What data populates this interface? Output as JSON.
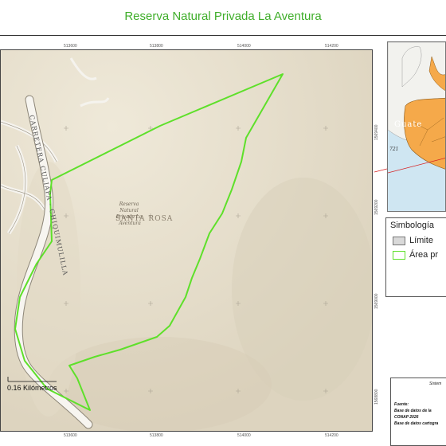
{
  "title": "Reserva Natural Privada La Aventura",
  "map": {
    "x_ticks": [
      "513600",
      "513800",
      "514000",
      "514200"
    ],
    "y_ticks": [
      "1569400",
      "1569200",
      "1569000",
      "1568800"
    ],
    "road_label": "CARRETERA CULIAPA - CHIQUIMULILLA",
    "place_label": "SANTA ROSA",
    "reserve_label": [
      "Reserva",
      "Natural",
      "Privada La",
      "Aventura"
    ],
    "scale_text": "0.16 Kilómetros",
    "colors": {
      "boundary": "#5ee02a",
      "terrain": "#e9e2d0",
      "road": "#ffffff"
    }
  },
  "inset": {
    "country_label": "Guate",
    "number_label": "721",
    "colors": {
      "sea": "#cfe6f2",
      "land": "#f2f2ee",
      "guatemala": "#f5a94a",
      "pointer": "#d62020"
    }
  },
  "legend": {
    "title": "Simbología",
    "items": [
      {
        "label": "Límite",
        "fill": "#d9d9d9",
        "stroke": "#777777"
      },
      {
        "label": "Área pr",
        "fill": "#ffffff",
        "stroke": "#5ee02a"
      }
    ]
  },
  "info": {
    "heading": "Sistem",
    "lines": [
      "Fuente:",
      "Base de datos de la",
      "CONAP 2026",
      "Base de datos cartogra"
    ]
  }
}
